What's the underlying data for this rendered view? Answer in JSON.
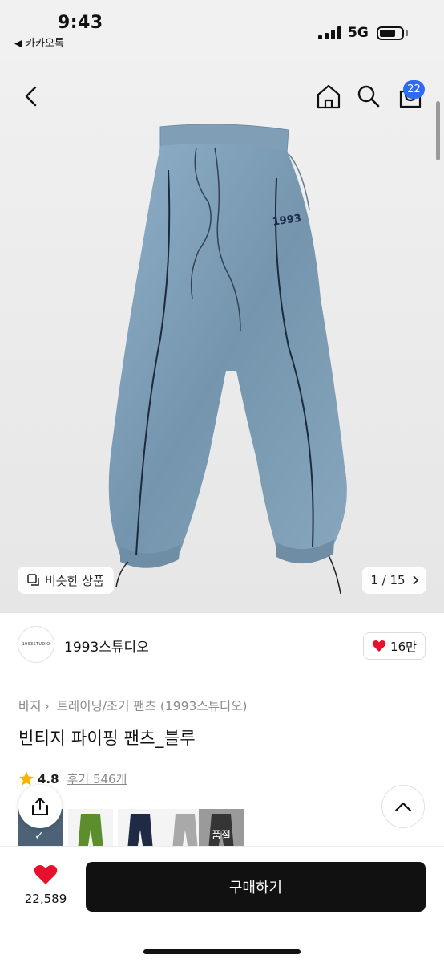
{
  "status_bar": {
    "time": "9:43",
    "back_app": "◀ 카카오톡",
    "network": "5G"
  },
  "header": {
    "cart_count": "22"
  },
  "gallery": {
    "similar_label": "비슷한 상품",
    "page": "1 / 15"
  },
  "brand": {
    "logo_text": "1993STUDIO",
    "name": "1993스튜디오",
    "likes": "16만"
  },
  "breadcrumb": [
    "바지",
    "트레이닝/조거 팬츠 (1993스튜디오)"
  ],
  "product": {
    "title": "빈티지 파이핑 팬츠_블루",
    "rating": "4.8",
    "reviews": "후기 546개"
  },
  "variants": [
    {
      "color": "#5e7388",
      "state": "selected"
    },
    {
      "color": "#5c8e2e",
      "state": "normal"
    },
    {
      "color": "#1f2a44",
      "state": "normal"
    },
    {
      "color": "#a9a9a9",
      "state": "normal"
    },
    {
      "color": "#151515",
      "state": "soldout",
      "label": "품절"
    }
  ],
  "bottom": {
    "wish_count": "22,589",
    "buy_label": "구매하기"
  },
  "colors": {
    "accent_blue": "#2f6af0",
    "heart_red": "#e8112d",
    "pants_blue": "#7f9eb6"
  }
}
